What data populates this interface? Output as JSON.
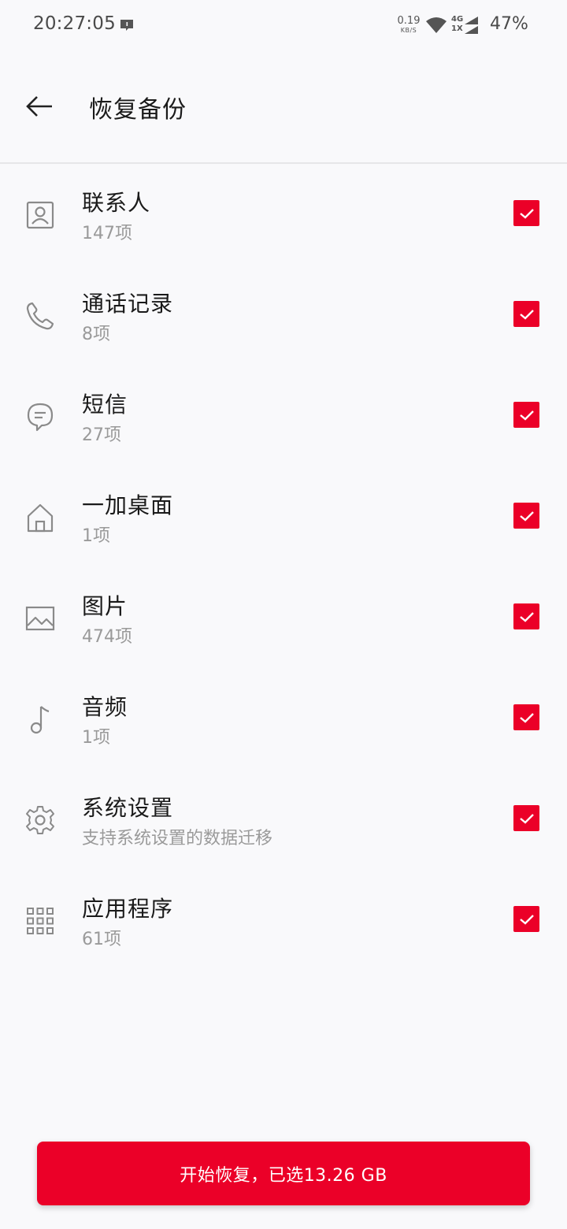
{
  "status_bar": {
    "time": "20:27:05",
    "net_speed_value": "0.19",
    "net_speed_unit": "KB/S",
    "network_type_top": "4G",
    "network_type_bottom": "1X",
    "battery": "47%"
  },
  "header": {
    "title": "恢复备份"
  },
  "items": [
    {
      "title": "联系人",
      "subtitle": "147项",
      "icon": "contacts-icon",
      "checked": true
    },
    {
      "title": "通话记录",
      "subtitle": "8项",
      "icon": "phone-icon",
      "checked": true
    },
    {
      "title": "短信",
      "subtitle": "27项",
      "icon": "message-icon",
      "checked": true
    },
    {
      "title": "一加桌面",
      "subtitle": "1项",
      "icon": "home-icon",
      "checked": true
    },
    {
      "title": "图片",
      "subtitle": "474项",
      "icon": "image-icon",
      "checked": true
    },
    {
      "title": "音频",
      "subtitle": "1项",
      "icon": "music-icon",
      "checked": true
    },
    {
      "title": "系统设置",
      "subtitle": "支持系统设置的数据迁移",
      "icon": "gear-icon",
      "checked": true
    },
    {
      "title": "应用程序",
      "subtitle": "61项",
      "icon": "apps-grid-icon",
      "checked": true
    }
  ],
  "footer": {
    "restore_label": "开始恢复，已选13.26  GB"
  },
  "colors": {
    "accent": "#eb0028",
    "background": "#f9f9fb",
    "icon_gray": "#8a8a8a"
  }
}
